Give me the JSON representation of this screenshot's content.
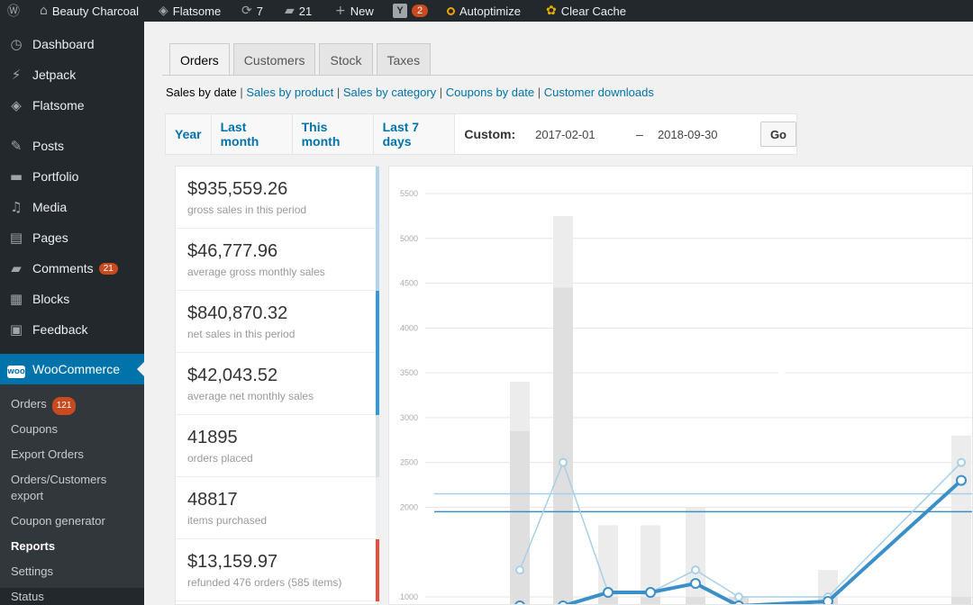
{
  "adminbar": {
    "site_name": "Beauty Charcoal",
    "theme": "Flatsome",
    "updates_count": "7",
    "comments_count": "21",
    "new_label": "New",
    "yoast_count": "2",
    "autoptimize_label": "Autoptimize",
    "clear_cache_label": "Clear Cache"
  },
  "sidebar": {
    "items": [
      {
        "label": "Dashboard",
        "icon": "dashboard-icon",
        "glyph": "◷"
      },
      {
        "label": "Jetpack",
        "icon": "jetpack-icon",
        "glyph": "⚡"
      },
      {
        "label": "Flatsome",
        "icon": "flatsome-icon",
        "glyph": "◈"
      },
      {
        "label": "Posts",
        "icon": "pin-icon",
        "glyph": "✎"
      },
      {
        "label": "Portfolio",
        "icon": "folder-icon",
        "glyph": "▬"
      },
      {
        "label": "Media",
        "icon": "media-icon",
        "glyph": "♫"
      },
      {
        "label": "Pages",
        "icon": "pages-icon",
        "glyph": "▤"
      },
      {
        "label": "Comments",
        "icon": "comment-icon",
        "glyph": "▰",
        "badge": "21"
      },
      {
        "label": "Blocks",
        "icon": "blocks-icon",
        "glyph": "▦"
      },
      {
        "label": "Feedback",
        "icon": "feedback-icon",
        "glyph": "▣"
      }
    ],
    "woocommerce": {
      "label": "WooCommerce",
      "logo": "WOO"
    },
    "submenu": [
      {
        "label": "Orders",
        "badge": "121"
      },
      {
        "label": "Coupons"
      },
      {
        "label": "Export Orders"
      },
      {
        "label": "Orders/Customers export"
      },
      {
        "label": "Coupon generator"
      },
      {
        "label": "Reports"
      },
      {
        "label": "Settings"
      },
      {
        "label": "Status"
      }
    ]
  },
  "tabs": [
    "Orders",
    "Customers",
    "Stock",
    "Taxes"
  ],
  "report_links": {
    "current": "Sales by date",
    "links": [
      "Sales by product",
      "Sales by category",
      "Coupons by date",
      "Customer downloads"
    ]
  },
  "range": {
    "tabs": [
      "Year",
      "Last month",
      "This month",
      "Last 7 days"
    ],
    "custom_label": "Custom:",
    "start_date": "2017-02-01",
    "dash": "–",
    "end_date": "2018-09-30",
    "go_label": "Go"
  },
  "stats": [
    {
      "value": "$935,559.26",
      "desc": "gross sales in this period",
      "color": "#b1d4ea"
    },
    {
      "value": "$46,777.96",
      "desc": "average gross monthly sales",
      "color": "#b1d4ea"
    },
    {
      "value": "$840,870.32",
      "desc": "net sales in this period",
      "color": "#3498db"
    },
    {
      "value": "$42,043.52",
      "desc": "average net monthly sales",
      "color": "#3498db"
    },
    {
      "value": "41895",
      "desc": "orders placed",
      "color": "#dbe1e3"
    },
    {
      "value": "48817",
      "desc": "items purchased",
      "color": "#ecf0f1"
    },
    {
      "value": "$13,159.97",
      "desc": "refunded 476 orders (585 items)",
      "color": "#e74c3c"
    }
  ],
  "chart_data": {
    "type": "bar",
    "y_ticks": [
      1000,
      2000,
      2500,
      3000,
      3500,
      4000,
      4500,
      5000,
      5500
    ],
    "ylim": [
      1000,
      5500
    ],
    "bars_total": [
      3400,
      5250,
      1800,
      1800,
      2000,
      1000,
      1300,
      2800
    ],
    "bars_inner": [
      2850,
      4450,
      1000,
      1000,
      1000,
      1000,
      1000,
      1000
    ],
    "series": [
      {
        "name_hidden": true,
        "values": [
          1300,
          2500,
          1050,
          1050,
          1300,
          1000,
          1000,
          2500
        ],
        "color": "#a8cfe8"
      },
      {
        "name_hidden": true,
        "values": [
          900,
          900,
          1050,
          1050,
          1150,
          900,
          950,
          2300
        ],
        "color": "#3a8fc9"
      }
    ],
    "avg_lines": [
      {
        "value": 2150,
        "color": "#a8cfe8"
      },
      {
        "value": 1950,
        "color": "#3a8fc9"
      }
    ]
  }
}
